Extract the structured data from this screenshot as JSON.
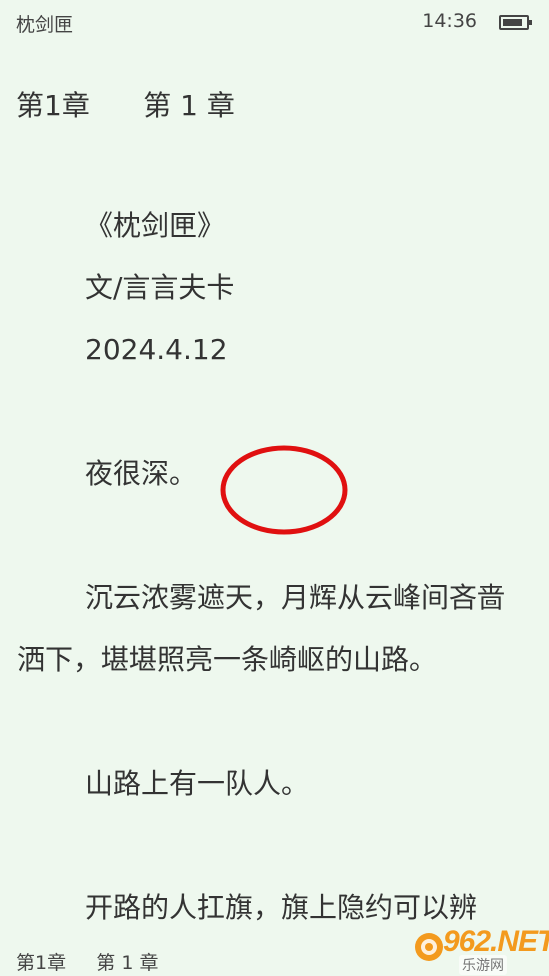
{
  "status_bar": {
    "book_title": "枕剑匣",
    "time": "14:36",
    "battery_level": 0.85,
    "icon": "battery-icon"
  },
  "header": {
    "chapter": "第1章      第 1 章"
  },
  "content": {
    "book_name": "《枕剑匣》",
    "author": "文/言言夫卡",
    "date": "2024.4.12",
    "paragraphs": [
      "夜很深。",
      "沉云浓雾遮天，月辉从云峰间吝啬洒下，堪堪照亮一条崎岖的山路。",
      "山路上有一队人。",
      "开路的人扛旗，旗上隐约可以辨"
    ]
  },
  "annotation": {
    "shape": "red-circle",
    "color": "#e01010"
  },
  "footer": {
    "chapter": "第1章     第 1 章"
  },
  "watermark": {
    "text": "962.NET",
    "sub": "乐游网",
    "color": "#f39a1e"
  }
}
